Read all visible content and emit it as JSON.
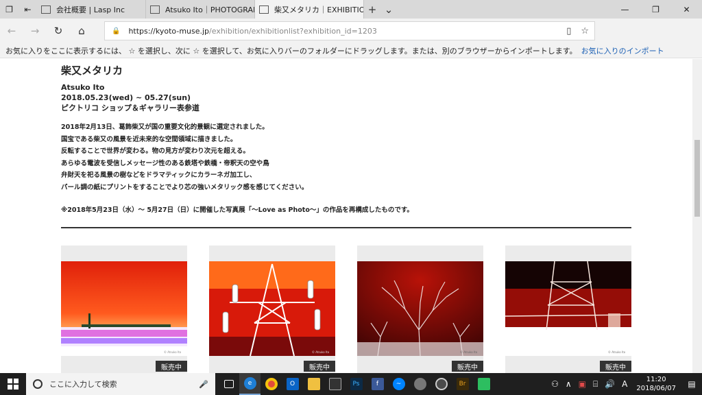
{
  "browser": {
    "tabs": [
      {
        "label": "会社概要 | Lasp Inc",
        "active": false
      },
      {
        "label": "Atsuko Ito｜PHOTOGRAPHI",
        "active": false
      },
      {
        "label": "柴又メタリカ｜EXHIBITIO",
        "active": true
      }
    ],
    "url_host": "https://kyoto-muse.jp",
    "url_path": "/exhibition/exhibitionlist?exhibition_id=1203",
    "favbar_text": "お気に入りをここに表示するには、 ☆ を選択し、次に ☆ を選択して、お気に入りバーのフォルダーにドラッグします。または、別のブラウザーからインポートします。",
    "favbar_link": "お気に入りのインポート"
  },
  "exhibition": {
    "title": "柴又メタリカ",
    "artist": "Atsuko Ito",
    "dates": "2018.05.23(wed) ~ 05.27(sun)",
    "venue": "ピクトリコ ショップ＆ギャラリー表参道",
    "description": [
      "2018年2月13日、葛飾柴又が国の重要文化的景観に選定されました。",
      "国宝である柴又の風景を近未来的な空間領域に描きました。",
      "反転することで世界が変わる。物の見方が変わり次元を超える。",
      "あらゆる電波を受信しメッセージ性のある鉄塔や鉄橋・帝釈天の空や鳥",
      "弁財天を祀る風景の樹などをドラマティックにカラーネガ加工し、",
      "パール調の紙にプリントをすることでより芯の強いメタリック感を感じてください。"
    ],
    "note": "※2018年5月23日（水）～ 5月27日（日）に開催した写真展「～Love as Photo～」の作品を再構成したものです。"
  },
  "works": [
    {
      "badge": "販売中",
      "caption": "© Atsuko Ito"
    },
    {
      "badge": "販売中",
      "caption": "© Atsuko Ito"
    },
    {
      "badge": "販売中",
      "caption": "© Atsuko Ito"
    },
    {
      "badge": "販売中",
      "caption": "© Atsuko Ito"
    }
  ],
  "taskbar": {
    "search_placeholder": "ここに入力して検索",
    "time": "11:20",
    "date": "2018/06/07",
    "ime": "A"
  }
}
